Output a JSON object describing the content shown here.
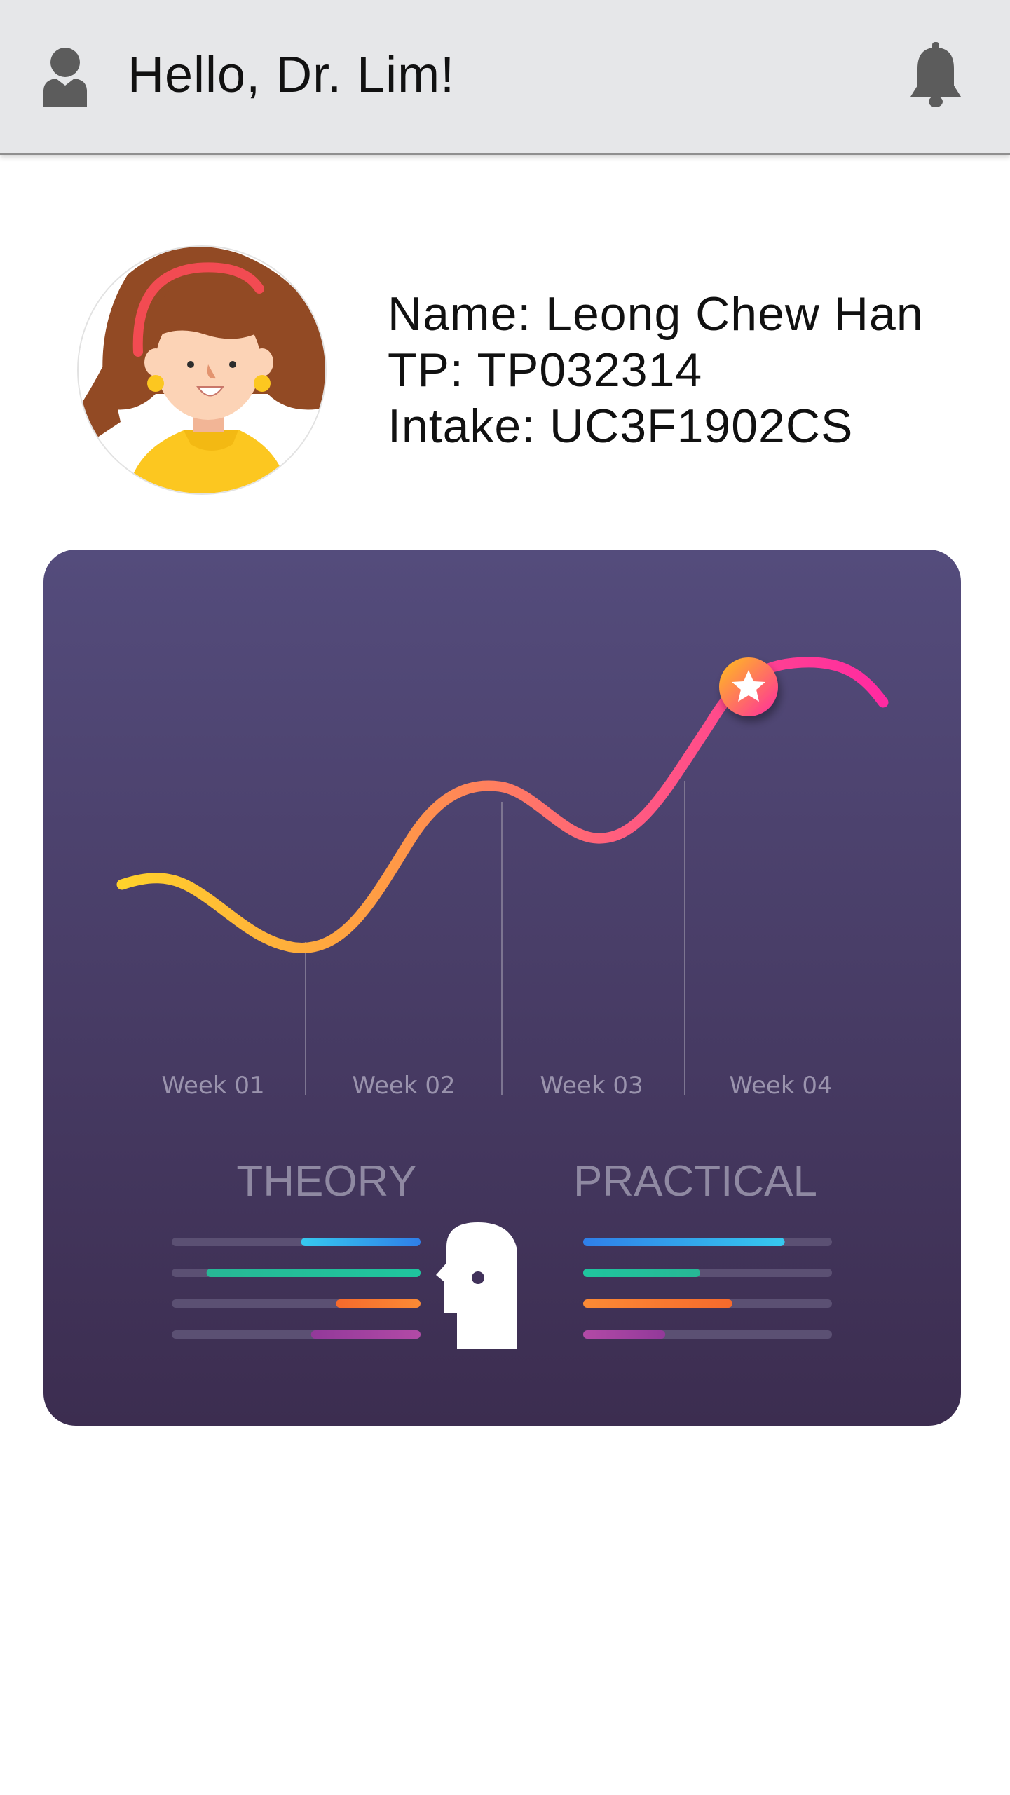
{
  "header": {
    "greeting": "Hello, Dr. Lim!",
    "user_icon": "user-icon",
    "notification_icon": "bell-icon"
  },
  "profile": {
    "name_line": "Name: Leong Chew Han",
    "tp_line": "TP: TP032314",
    "intake_line": "Intake: UC3F1902CS"
  },
  "progress_card": {
    "weeks": [
      "Week 01",
      "Week 02",
      "Week 03",
      "Week 04"
    ],
    "theory_label": "THEORY",
    "practical_label": "PRACTICAL",
    "theory_bars": [
      {
        "fill": 0.48,
        "from": "#36c9ef",
        "to": "#2f7fe9"
      },
      {
        "fill": 0.86,
        "from": "#27b795",
        "to": "#1fc59e"
      },
      {
        "fill": 0.34,
        "from": "#f66a2c",
        "to": "#fb8a35"
      },
      {
        "fill": 0.44,
        "from": "#92399a",
        "to": "#b24aa6"
      }
    ],
    "practical_bars": [
      {
        "fill": 0.81,
        "from": "#2f7fe9",
        "to": "#36c9ef"
      },
      {
        "fill": 0.47,
        "from": "#1fc59e",
        "to": "#27b795"
      },
      {
        "fill": 0.6,
        "from": "#fb8a35",
        "to": "#f66a2c"
      },
      {
        "fill": 0.33,
        "from": "#b24aa6",
        "to": "#92399a"
      }
    ],
    "track_color": "#5b5073",
    "curve_colors": [
      "#ffd22b",
      "#ff9a45",
      "#ff5e7e",
      "#ff2aa1"
    ],
    "marker_icon": "star-icon"
  }
}
